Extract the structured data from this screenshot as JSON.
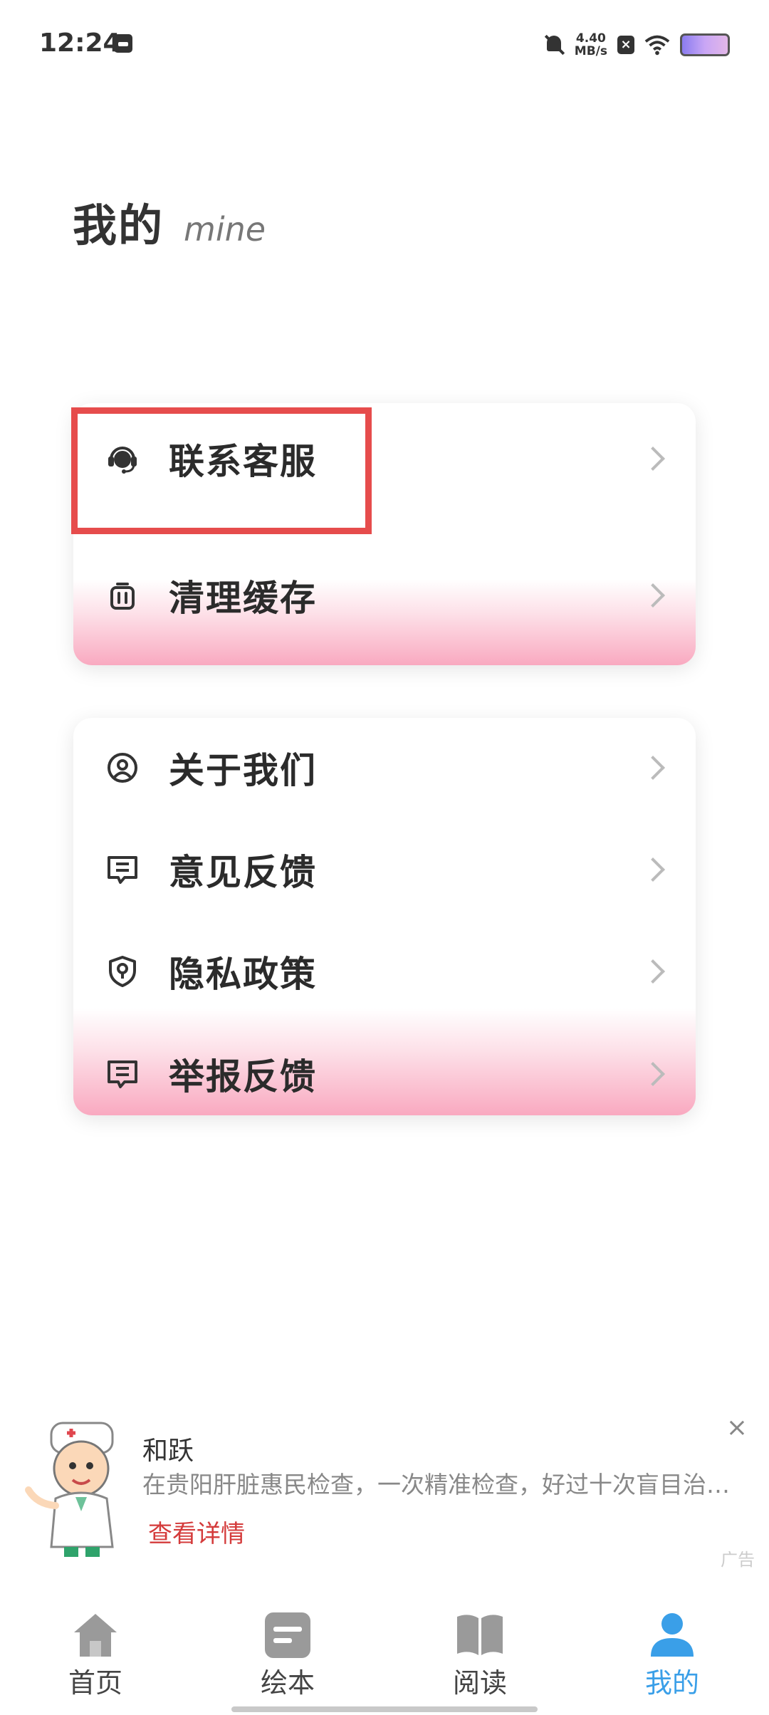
{
  "status_bar": {
    "time": "12:24",
    "speed_value": "4.40",
    "speed_unit": "MB/s"
  },
  "header": {
    "title": "我的",
    "subtitle": "mine"
  },
  "menu_group_1": [
    {
      "label": "联系客服",
      "icon": "headset-icon"
    },
    {
      "label": "清理缓存",
      "icon": "trash-icon"
    }
  ],
  "menu_group_2": [
    {
      "label": "关于我们",
      "icon": "user-circle-icon"
    },
    {
      "label": "意见反馈",
      "icon": "message-icon"
    },
    {
      "label": "隐私政策",
      "icon": "shield-icon"
    },
    {
      "label": "举报反馈",
      "icon": "message-icon"
    }
  ],
  "ad": {
    "brand": "和跃",
    "description": "在贵阳肝脏惠民检查，一次精准检查，好过十次盲目治…",
    "cta": "查看详情",
    "close": "×",
    "tag": "广告"
  },
  "tabbar": {
    "items": [
      {
        "label": "首页",
        "icon": "home-icon"
      },
      {
        "label": "绘本",
        "icon": "picture-book-icon"
      },
      {
        "label": "阅读",
        "icon": "book-icon"
      },
      {
        "label": "我的",
        "icon": "person-icon",
        "active": true
      }
    ]
  },
  "colors": {
    "accent": "#3a9fe8",
    "highlight": "#e64c4c",
    "card_gradient_pink": "#f9a9c0",
    "cta_red": "#d43b3b"
  }
}
